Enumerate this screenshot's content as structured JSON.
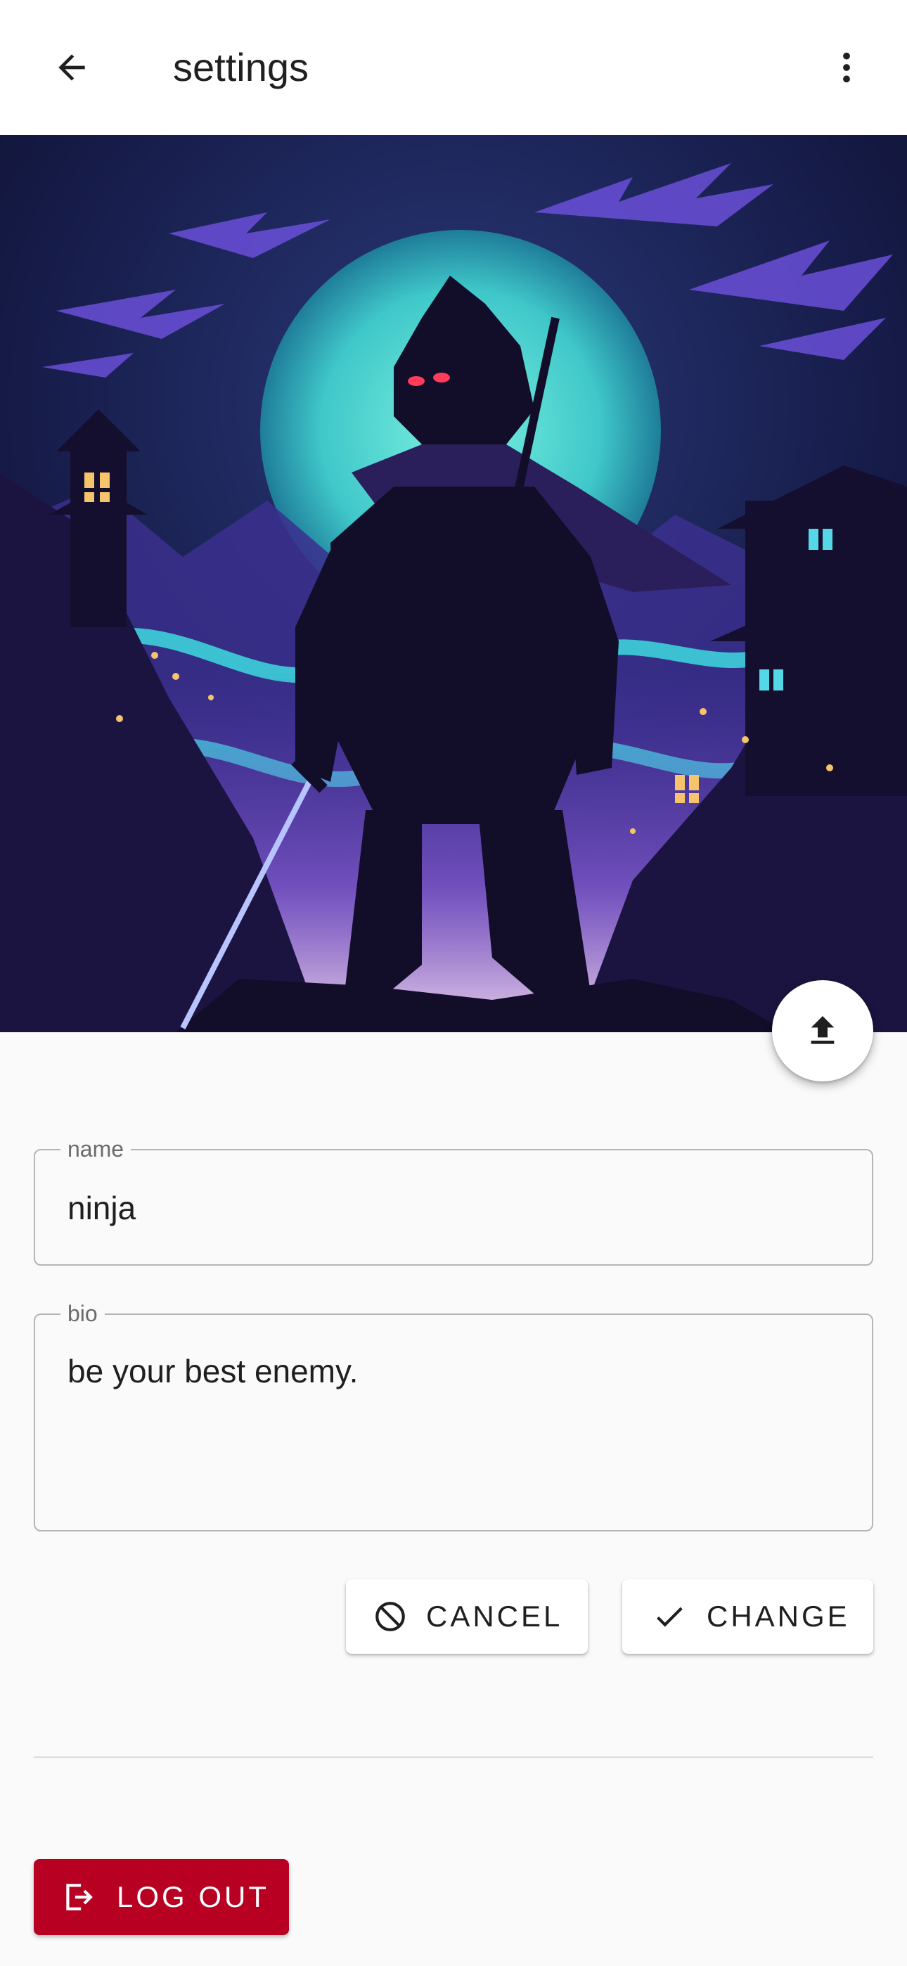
{
  "appbar": {
    "title": "settings",
    "back_icon": "arrow-left-icon",
    "menu_icon": "more-vert-icon"
  },
  "hero": {
    "description_icon": "profile-banner-image",
    "upload_icon": "upload-icon"
  },
  "form": {
    "name": {
      "label": "name",
      "value": "ninja"
    },
    "bio": {
      "label": "bio",
      "value": "be your best enemy."
    }
  },
  "actions": {
    "cancel_label": "CANCEL",
    "cancel_icon": "block-icon",
    "change_label": "CHANGE",
    "change_icon": "check-icon"
  },
  "logout": {
    "label": "LOG OUT",
    "icon": "logout-icon"
  },
  "colors": {
    "logout_bg": "#b80022",
    "appbar_bg": "#ffffff",
    "page_bg": "#fafafa"
  }
}
